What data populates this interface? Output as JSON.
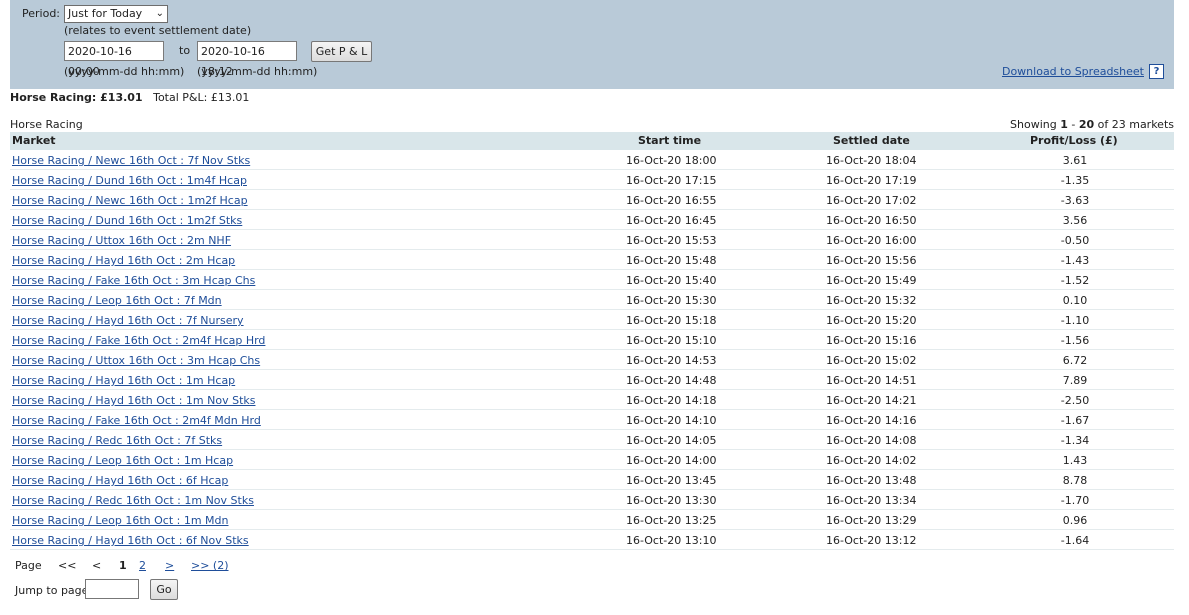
{
  "filter": {
    "period_label": "Period:",
    "period_value": "Just for Today",
    "period_note": "(relates to event settlement date)",
    "from_value": "2020-10-16 00:00",
    "to_label": "to",
    "to_value": "2020-10-16 18:12",
    "format_hint": "(yyyy-mm-dd hh:mm)",
    "get_button": "Get P & L",
    "download_link": "Download to Spreadsheet",
    "help": "?"
  },
  "summary": {
    "category": "Horse Racing: £13.01",
    "total": "Total P&L: £13.01"
  },
  "section_title": "Horse Racing",
  "showing": {
    "prefix": "Showing ",
    "from": "1",
    "sep": " - ",
    "to": "20",
    "suffix": " of 23 markets"
  },
  "table": {
    "headers": {
      "market": "Market",
      "start": "Start time",
      "settled": "Settled date",
      "pl": "Profit/Loss (£)"
    },
    "rows": [
      {
        "market": "Horse Racing / Newc 16th Oct : 7f Nov Stks",
        "start": "16-Oct-20 18:00",
        "settled": "16-Oct-20 18:04",
        "pl": "3.61"
      },
      {
        "market": "Horse Racing / Dund 16th Oct : 1m4f Hcap",
        "start": "16-Oct-20 17:15",
        "settled": "16-Oct-20 17:19",
        "pl": "-1.35"
      },
      {
        "market": "Horse Racing / Newc 16th Oct : 1m2f Hcap",
        "start": "16-Oct-20 16:55",
        "settled": "16-Oct-20 17:02",
        "pl": "-3.63"
      },
      {
        "market": "Horse Racing / Dund 16th Oct : 1m2f Stks",
        "start": "16-Oct-20 16:45",
        "settled": "16-Oct-20 16:50",
        "pl": "3.56"
      },
      {
        "market": "Horse Racing / Uttox 16th Oct : 2m NHF",
        "start": "16-Oct-20 15:53",
        "settled": "16-Oct-20 16:00",
        "pl": "-0.50"
      },
      {
        "market": "Horse Racing / Hayd 16th Oct : 2m Hcap",
        "start": "16-Oct-20 15:48",
        "settled": "16-Oct-20 15:56",
        "pl": "-1.43"
      },
      {
        "market": "Horse Racing / Fake 16th Oct : 3m Hcap Chs",
        "start": "16-Oct-20 15:40",
        "settled": "16-Oct-20 15:49",
        "pl": "-1.52"
      },
      {
        "market": "Horse Racing / Leop 16th Oct : 7f Mdn",
        "start": "16-Oct-20 15:30",
        "settled": "16-Oct-20 15:32",
        "pl": "0.10"
      },
      {
        "market": "Horse Racing / Hayd 16th Oct : 7f Nursery",
        "start": "16-Oct-20 15:18",
        "settled": "16-Oct-20 15:20",
        "pl": "-1.10"
      },
      {
        "market": "Horse Racing / Fake 16th Oct : 2m4f Hcap Hrd",
        "start": "16-Oct-20 15:10",
        "settled": "16-Oct-20 15:16",
        "pl": "-1.56"
      },
      {
        "market": "Horse Racing / Uttox 16th Oct : 3m Hcap Chs",
        "start": "16-Oct-20 14:53",
        "settled": "16-Oct-20 15:02",
        "pl": "6.72"
      },
      {
        "market": "Horse Racing / Hayd 16th Oct : 1m Hcap",
        "start": "16-Oct-20 14:48",
        "settled": "16-Oct-20 14:51",
        "pl": "7.89"
      },
      {
        "market": "Horse Racing / Hayd 16th Oct : 1m Nov Stks",
        "start": "16-Oct-20 14:18",
        "settled": "16-Oct-20 14:21",
        "pl": "-2.50"
      },
      {
        "market": "Horse Racing / Fake 16th Oct : 2m4f Mdn Hrd",
        "start": "16-Oct-20 14:10",
        "settled": "16-Oct-20 14:16",
        "pl": "-1.67"
      },
      {
        "market": "Horse Racing / Redc 16th Oct : 7f Stks",
        "start": "16-Oct-20 14:05",
        "settled": "16-Oct-20 14:08",
        "pl": "-1.34"
      },
      {
        "market": "Horse Racing / Leop 16th Oct : 1m Hcap",
        "start": "16-Oct-20 14:00",
        "settled": "16-Oct-20 14:02",
        "pl": "1.43"
      },
      {
        "market": "Horse Racing / Hayd 16th Oct : 6f Hcap",
        "start": "16-Oct-20 13:45",
        "settled": "16-Oct-20 13:48",
        "pl": "8.78"
      },
      {
        "market": "Horse Racing / Redc 16th Oct : 1m Nov Stks",
        "start": "16-Oct-20 13:30",
        "settled": "16-Oct-20 13:34",
        "pl": "-1.70"
      },
      {
        "market": "Horse Racing / Leop 16th Oct : 1m Mdn",
        "start": "16-Oct-20 13:25",
        "settled": "16-Oct-20 13:29",
        "pl": "0.96"
      },
      {
        "market": "Horse Racing / Hayd 16th Oct : 6f Nov Stks",
        "start": "16-Oct-20 13:10",
        "settled": "16-Oct-20 13:12",
        "pl": "-1.64"
      }
    ]
  },
  "pager": {
    "label": "Page",
    "first": "<<",
    "prev": "<",
    "current": "1",
    "page2": "2",
    "next": ">",
    "last": ">> (2)",
    "jump_label": "Jump to page",
    "go": "Go"
  }
}
